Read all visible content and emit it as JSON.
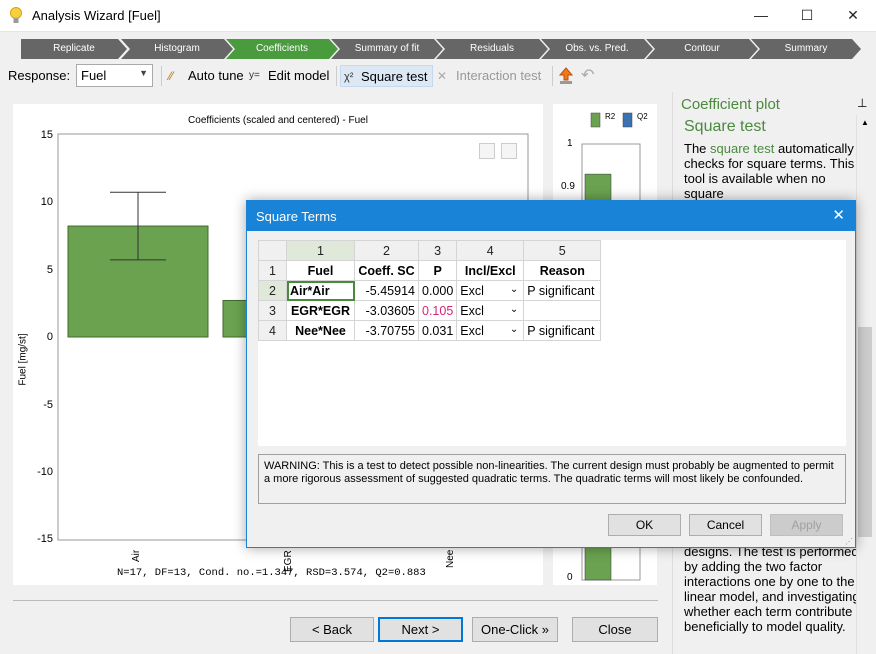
{
  "window": {
    "title": "Analysis Wizard [Fuel]"
  },
  "steps": [
    "Replicate",
    "Histogram",
    "Coefficients",
    "Summary of fit",
    "Residuals",
    "Obs. vs. Pred.",
    "Contour",
    "Summary"
  ],
  "active_step": 2,
  "toolbar": {
    "response_label": "Response:",
    "response_value": "Fuel",
    "auto_tune": "Auto tune",
    "edit_model": "Edit model",
    "square_test": "Square test",
    "interaction_test": "Interaction test"
  },
  "chart_data": [
    {
      "type": "bar",
      "title": "Coefficients (scaled and centered) - Fuel",
      "ylabel": "Fuel [mg/st]",
      "categories": [
        "Air",
        "EGR",
        "Nee"
      ],
      "values": [
        8.2,
        2.7,
        null
      ],
      "error_bars": [
        {
          "category": "Air",
          "low": 5.7,
          "high": 10.7
        }
      ],
      "ylim": [
        -15,
        15
      ],
      "yticks": [
        "15",
        "10",
        "5",
        "0",
        "-5",
        "-10",
        "-15"
      ],
      "footer": "N=17, DF=13, Cond. no.=1.347, RSD=3.574, Q2=0.883"
    },
    {
      "type": "bar",
      "series": [
        {
          "name": "R2"
        },
        {
          "name": "Q2"
        }
      ],
      "yticks": [
        "1",
        "0.9",
        "0"
      ],
      "values": {
        "R2": 0.93,
        "Q2": 0.88
      },
      "colors": {
        "R2": "#6aa250",
        "Q2": "#3a72b4"
      }
    }
  ],
  "side": {
    "header": "Coefficient plot",
    "subheader": "Square test",
    "text_before_link": "The ",
    "link": "square test",
    "text_after_link": " automatically checks for square terms. This tool is available when no square",
    "text_bottom": "designs. The test is performed by adding the two factor interactions one by one to the linear model, and investigating whether each term contribute beneficially to model quality."
  },
  "bottom_buttons": {
    "back": "< Back",
    "next": "Next >",
    "oneclick": "One-Click »",
    "close": "Close"
  },
  "dialog": {
    "title": "Square Terms",
    "col_numbers": [
      "1",
      "2",
      "3",
      "4",
      "5"
    ],
    "headers": [
      "Fuel",
      "Coeff. SC",
      "P",
      "Incl/Excl",
      "Reason"
    ],
    "rows": [
      {
        "n": "2",
        "term": "Air*Air",
        "coeff": "-5.45914",
        "p": "0.000",
        "incl": "Excl",
        "reason": "P significant"
      },
      {
        "n": "3",
        "term": "EGR*EGR",
        "coeff": "-3.03605",
        "p": "0.105",
        "incl": "Excl",
        "reason": ""
      },
      {
        "n": "4",
        "term": "Nee*Nee",
        "coeff": "-3.70755",
        "p": "0.031",
        "incl": "Excl",
        "reason": "P significant"
      }
    ],
    "warning": "WARNING: This is a test to detect possible non-linearities. The current design must probably be augmented to permit a more rigorous assessment of suggested quadratic terms. The quadratic terms will most likely be confounded.",
    "ok": "OK",
    "cancel": "Cancel",
    "apply": "Apply"
  },
  "colors": {
    "accent": "#1883d7",
    "bar_green": "#6aa250",
    "step_active": "#4a9a3e",
    "link_green": "#4a8a3c"
  }
}
